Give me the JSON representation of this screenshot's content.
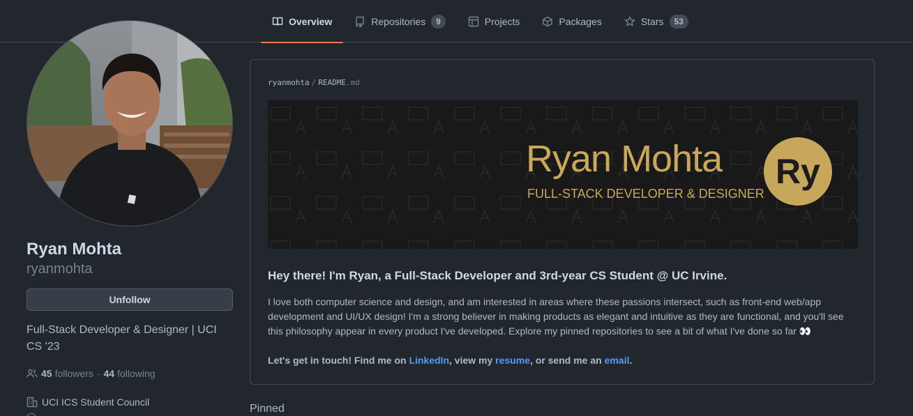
{
  "tabs": [
    {
      "label": "Overview",
      "icon": "book-icon",
      "active": true
    },
    {
      "label": "Repositories",
      "icon": "repo-icon",
      "count": "9"
    },
    {
      "label": "Projects",
      "icon": "table-icon"
    },
    {
      "label": "Packages",
      "icon": "package-icon"
    },
    {
      "label": "Stars",
      "icon": "star-icon",
      "count": "53"
    }
  ],
  "profile": {
    "full_name": "Ryan Mohta",
    "username": "ryanmohta",
    "unfollow_label": "Unfollow",
    "bio": "Full-Stack Developer & Designer | UCI CS '23",
    "followers_count": "45",
    "followers_label": "followers",
    "separator": "·",
    "following_count": "44",
    "following_label": "following",
    "organization": "UCI ICS Student Council"
  },
  "readme": {
    "owner": "ryanmohta",
    "separator": "/",
    "file_base": "README",
    "file_ext": ".md",
    "banner_name": "Ryan Mohta",
    "banner_subtitle": "FULL-STACK DEVELOPER & DESIGNER",
    "banner_badge": "Ry",
    "heading": "Hey there! I'm Ryan, a Full-Stack Developer and 3rd-year CS Student @ UC Irvine.",
    "paragraph": "I love both computer science and design, and am interested in areas where these passions intersect, such as front-end web/app development and UI/UX design! I'm a strong believer in making products as elegant and intuitive as they are functional, and you'll see this philosophy appear in every product I've developed. Explore my pinned repositories to see a bit of what I've done so far 👀",
    "contact_prefix": "Let's get in touch! Find me on ",
    "linkedin_label": "LinkedIn",
    "contact_mid1": ", view my ",
    "resume_label": "resume",
    "contact_mid2": ", or send me an ",
    "email_label": "email",
    "contact_suffix": "."
  },
  "pinned_label": "Pinned",
  "colors": {
    "background": "#22272e",
    "accent_underline": "#ec775c",
    "link": "#539bf5",
    "banner_gold": "#c9a85a"
  }
}
